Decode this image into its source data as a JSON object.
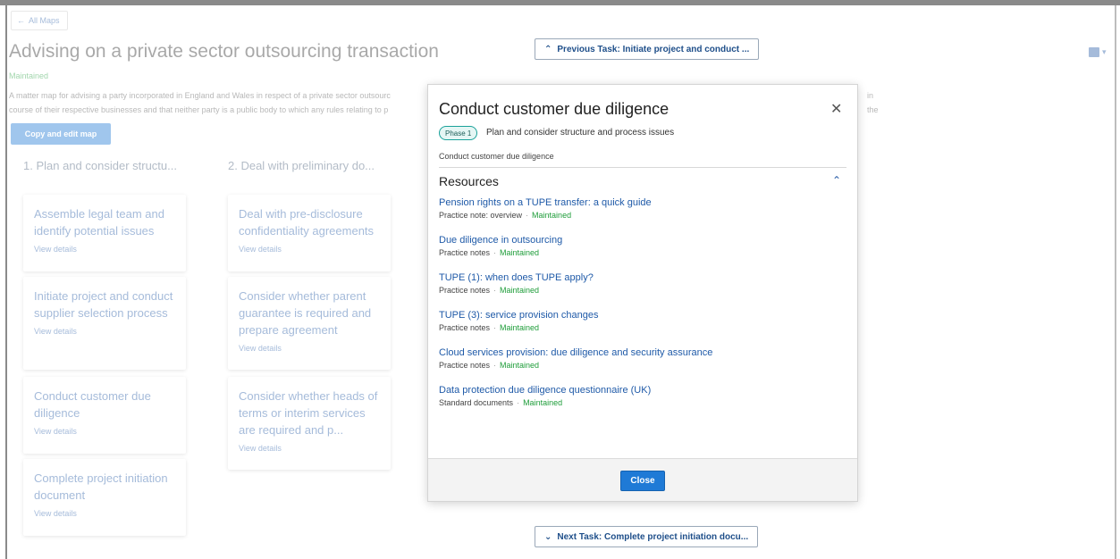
{
  "background": {
    "back_label": "All Maps",
    "title": "Advising on a private sector outsourcing transaction",
    "status": "Maintained",
    "description": "A matter map for advising a party incorporated in England and Wales in respect of a private sector outsourc",
    "description_tail": "in the",
    "description_line2": "course of their respective businesses and that neither party is a public body to which any rules relating to p",
    "copy_button": "Copy and edit map",
    "columns": [
      {
        "heading": "1. Plan and consider structu...",
        "cards": [
          {
            "title": "Assemble legal team and identify potential issues",
            "link": "View details"
          },
          {
            "title": "Initiate project and conduct supplier selection process",
            "link": "View details"
          },
          {
            "title": "Conduct customer due diligence",
            "link": "View details"
          },
          {
            "title": "Complete project initiation document",
            "link": "View details"
          }
        ]
      },
      {
        "heading": "2. Deal with preliminary do...",
        "cards": [
          {
            "title": "Deal with pre-disclosure confidentiality agreements",
            "link": "View details"
          },
          {
            "title": "Consider whether parent guarantee is required and prepare agreement",
            "link": "View details"
          },
          {
            "title": "Consider whether heads of terms or interim services are required and p...",
            "link": "View details"
          }
        ]
      }
    ]
  },
  "nav": {
    "previous": "Previous Task: Initiate project and conduct ...",
    "next": "Next Task: Complete project initiation docu..."
  },
  "modal": {
    "title": "Conduct customer due diligence",
    "phase_badge": "Phase 1",
    "phase_name": "Plan and consider structure and process issues",
    "subtitle": "Conduct customer due diligence",
    "resources_heading": "Resources",
    "resources": [
      {
        "title": "Pension rights on a TUPE transfer: a quick guide",
        "type": "Practice note: overview",
        "status": "Maintained"
      },
      {
        "title": "Due diligence in outsourcing",
        "type": "Practice notes",
        "status": "Maintained"
      },
      {
        "title": "TUPE (1): when does TUPE apply?",
        "type": "Practice notes",
        "status": "Maintained"
      },
      {
        "title": "TUPE (3): service provision changes",
        "type": "Practice notes",
        "status": "Maintained"
      },
      {
        "title": "Cloud services provision: due diligence and security assurance",
        "type": "Practice notes",
        "status": "Maintained"
      },
      {
        "title": "Data protection due diligence questionnaire (UK)",
        "type": "Standard documents",
        "status": "Maintained"
      }
    ],
    "close_label": "Close"
  },
  "colors": {
    "link": "#1f5aa8",
    "status_green": "#1f9d3a",
    "primary_button": "#1f7ad6",
    "phase_border": "#1aa29a"
  }
}
